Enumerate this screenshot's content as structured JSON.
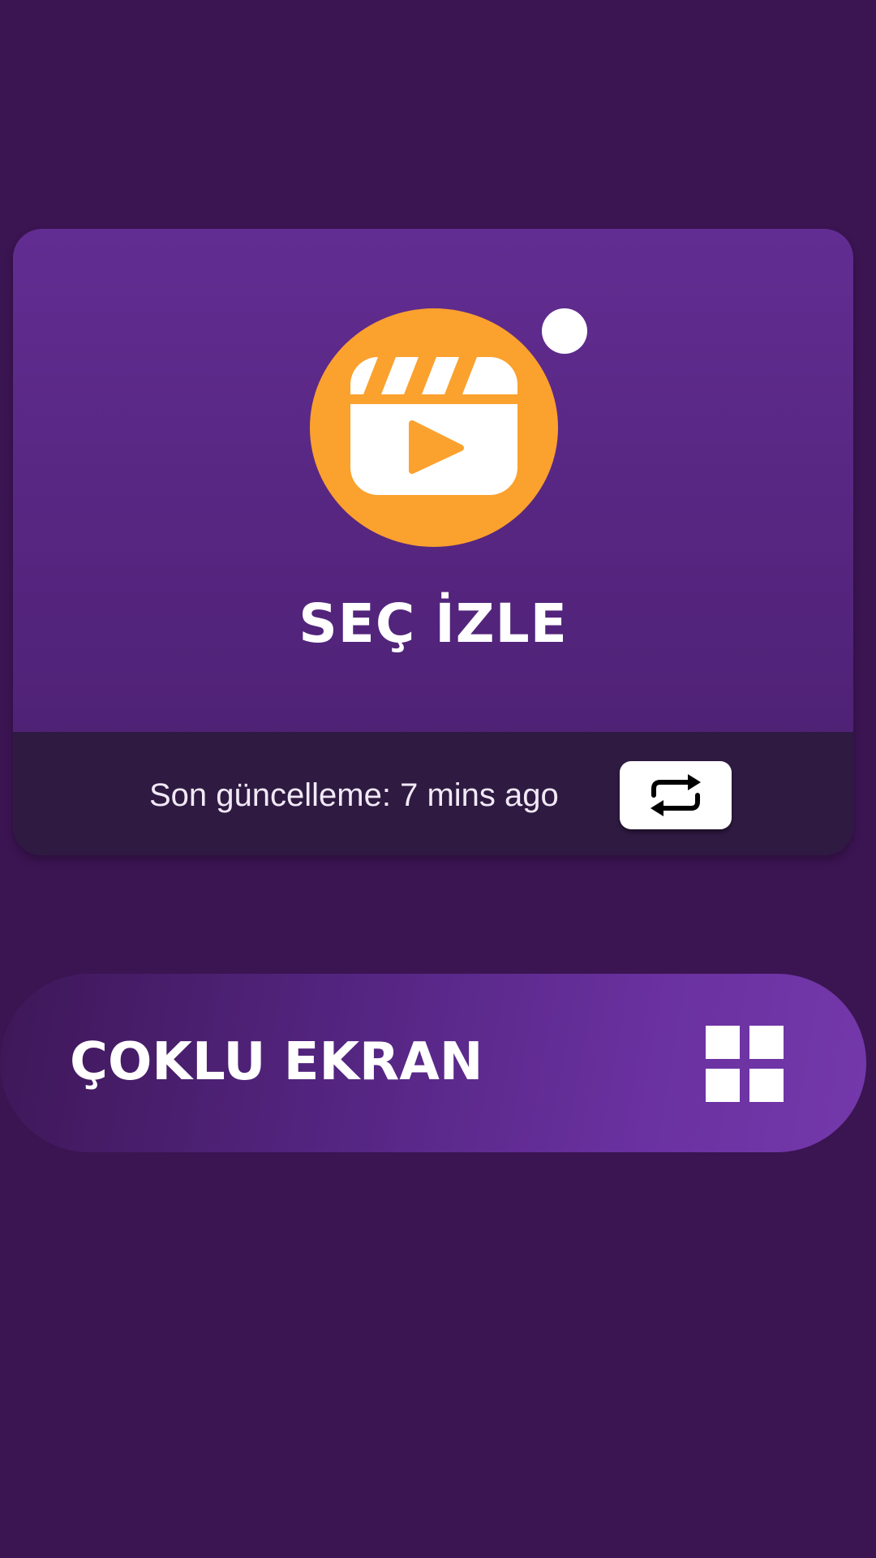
{
  "card": {
    "title": "SEÇ İZLE",
    "last_update": "Son güncelleme: 7 mins ago",
    "icon": "video-clapper-icon",
    "refresh_icon": "refresh-icon"
  },
  "multi_screen": {
    "label": "ÇOKLU EKRAN",
    "icon": "grid-icon"
  },
  "colors": {
    "background": "#3b1452",
    "card": "#622d92",
    "logo": "#fba12e",
    "footer": "#2f1a41",
    "button_gradient_end": "#7438aa"
  }
}
